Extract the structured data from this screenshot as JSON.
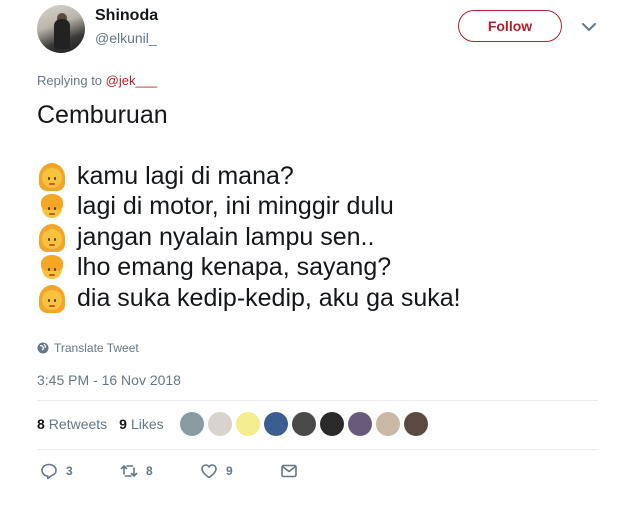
{
  "user": {
    "name": "Shinoda",
    "handle": "@elkunil_"
  },
  "header": {
    "follow_label": "Follow"
  },
  "reply": {
    "prefix": "Replying to ",
    "mention": "@jek___"
  },
  "tweet": {
    "title_line": "Cemburuan",
    "lines": [
      {
        "emoji": "girl",
        "text": "kamu lagi di mana?"
      },
      {
        "emoji": "boy",
        "text": "lagi di motor, ini minggir dulu"
      },
      {
        "emoji": "girl",
        "text": "jangan nyalain lampu sen.."
      },
      {
        "emoji": "boy",
        "text": "lho emang kenapa, sayang?"
      },
      {
        "emoji": "girl",
        "text": "dia suka kedip-kedip, aku ga suka!"
      }
    ]
  },
  "translate_label": "Translate Tweet",
  "timestamp": "3:45 PM - 16 Nov 2018",
  "stats": {
    "retweets_count": "8",
    "retweets_label": "Retweets",
    "likes_count": "9",
    "likes_label": "Likes"
  },
  "liker_avatar_colors": [
    "#8a9aa3",
    "#d8d4cc",
    "#f4ee8c",
    "#3b5d8f",
    "#4a4a4a",
    "#2a2a2a",
    "#6a5a7a",
    "#c9b9a6",
    "#5a4a42"
  ],
  "actions": {
    "reply_count": "3",
    "retweet_count": "8",
    "like_count": "9"
  },
  "colors": {
    "accent": "#b0222b",
    "muted": "#657786",
    "text": "#14171a"
  }
}
